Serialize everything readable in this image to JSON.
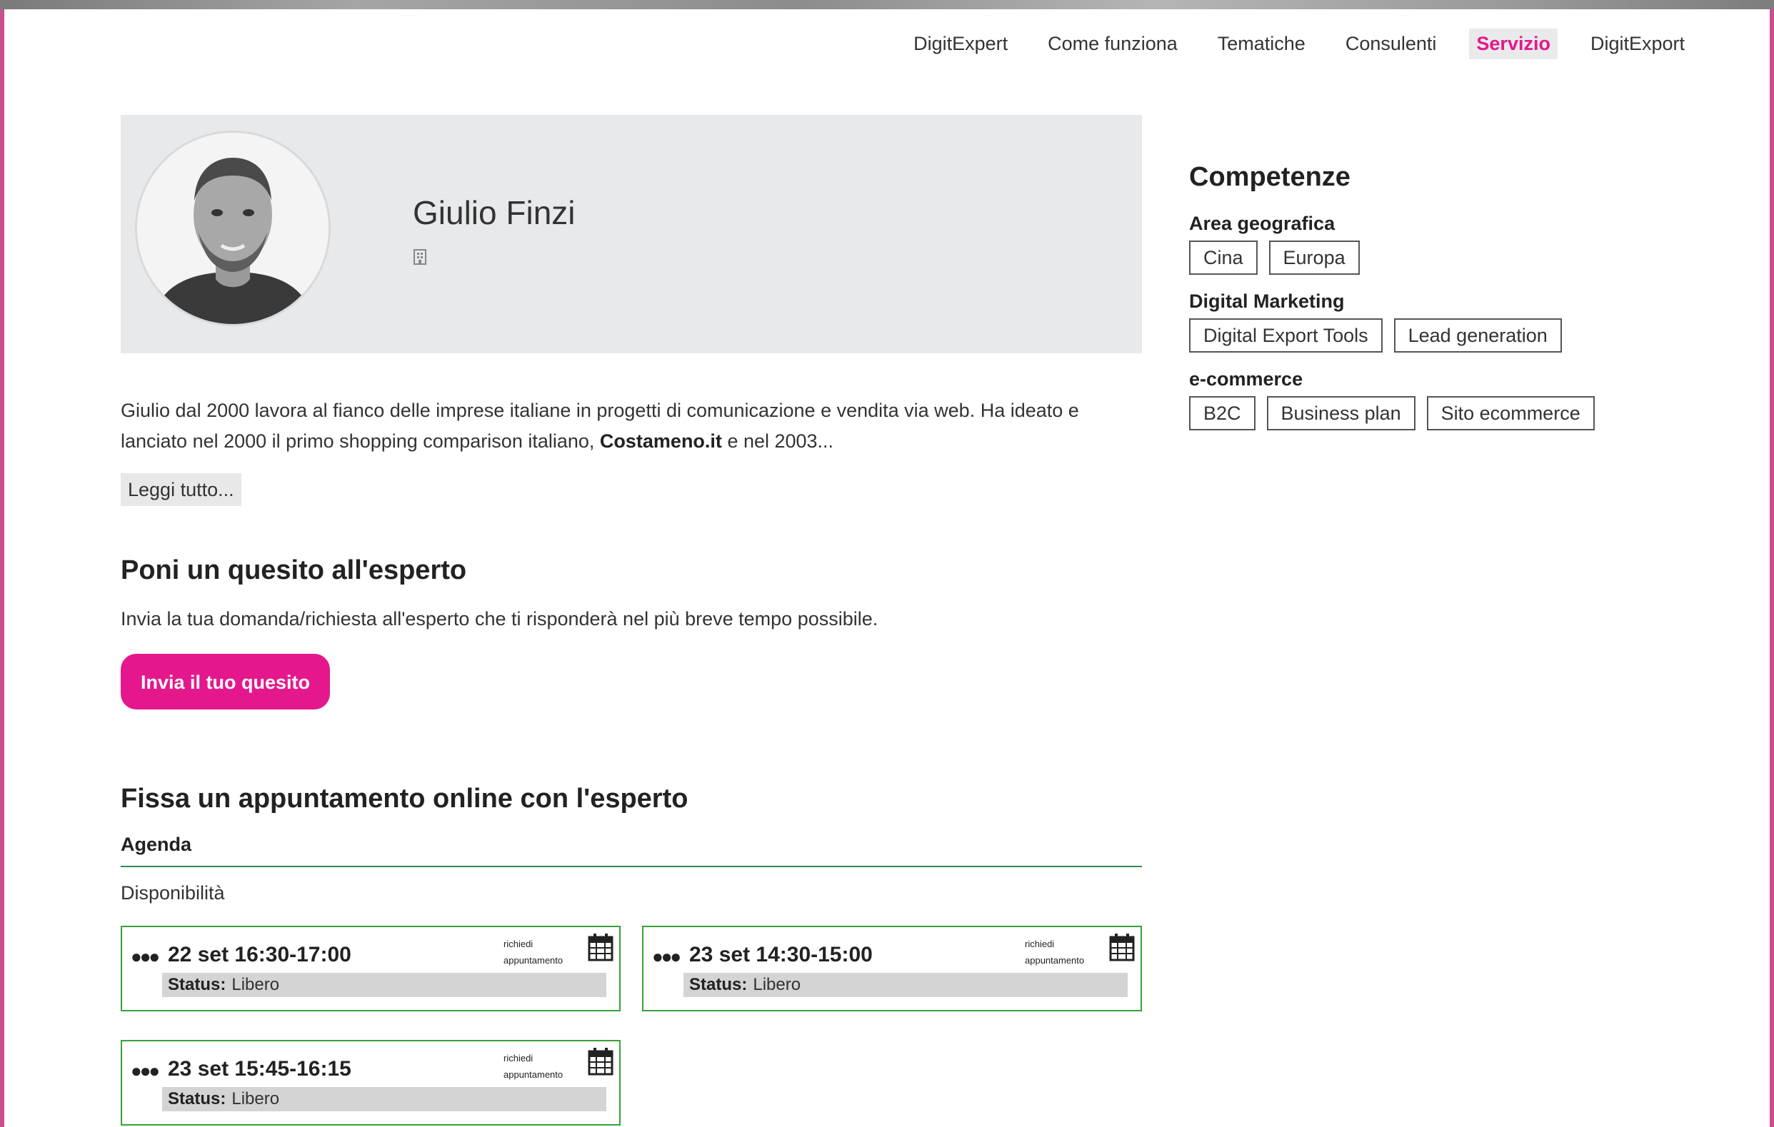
{
  "nav": {
    "items": [
      {
        "label": "DigitExpert",
        "active": false
      },
      {
        "label": "Come funziona",
        "active": false
      },
      {
        "label": "Tematiche",
        "active": false
      },
      {
        "label": "Consulenti",
        "active": false
      },
      {
        "label": "Servizio",
        "active": true
      },
      {
        "label": "DigitExport",
        "active": false
      }
    ]
  },
  "profile": {
    "name": "Giulio Finzi",
    "bio_before_bold": "Giulio dal 2000 lavora al fianco delle imprese italiane in progetti di comunicazione e vendita via web. Ha ideato e lanciato nel 2000 il primo shopping comparison italiano, ",
    "bio_bold": "Costameno.it",
    "bio_after_bold": " e nel 2003...",
    "read_more": "Leggi tutto..."
  },
  "question": {
    "title": "Poni un quesito all'esperto",
    "description": "Invia la tua domanda/richiesta all'esperto che ti risponderà nel più breve tempo possibile.",
    "button": "Invia il tuo quesito"
  },
  "appointment": {
    "title": "Fissa un appuntamento online con l'esperto",
    "agenda_label": "Agenda",
    "availability_label": "Disponibilità",
    "request_label_line1": "richiedi",
    "request_label_line2": "appuntamento",
    "status_label": "Status:",
    "slots": [
      {
        "time": "22 set 16:30-17:00",
        "status": "Libero"
      },
      {
        "time": "23 set 14:30-15:00",
        "status": "Libero"
      },
      {
        "time": "23 set 15:45-16:15",
        "status": "Libero"
      }
    ]
  },
  "competences": {
    "title": "Competenze",
    "groups": [
      {
        "title": "Area geografica",
        "tags": [
          "Cina",
          "Europa"
        ]
      },
      {
        "title": "Digital Marketing",
        "tags": [
          "Digital Export Tools",
          "Lead generation"
        ]
      },
      {
        "title": "e-commerce",
        "tags": [
          "B2C",
          "Business plan",
          "Sito ecommerce"
        ]
      }
    ]
  },
  "colors": {
    "accent": "#e4188c",
    "slot_border": "#3aa03a",
    "hero_bg": "#e8e9eb"
  }
}
